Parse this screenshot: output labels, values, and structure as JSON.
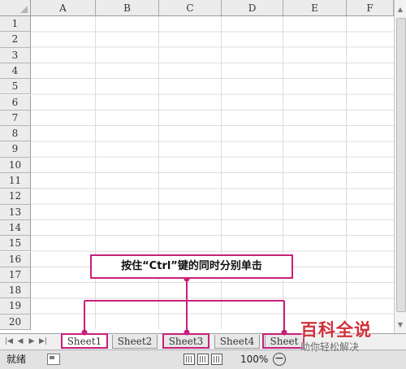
{
  "columns": [
    "A",
    "B",
    "C",
    "D",
    "E",
    "F"
  ],
  "rows": [
    "1",
    "2",
    "3",
    "4",
    "5",
    "6",
    "7",
    "8",
    "9",
    "10",
    "11",
    "12",
    "13",
    "14",
    "15",
    "16",
    "17",
    "18",
    "19",
    "20"
  ],
  "tabs": [
    {
      "label": "Sheet1",
      "highlighted": true
    },
    {
      "label": "Sheet2",
      "highlighted": false
    },
    {
      "label": "Sheet3",
      "highlighted": true
    },
    {
      "label": "Sheet4",
      "highlighted": false
    },
    {
      "label": "Sheet",
      "highlighted": true
    }
  ],
  "status": {
    "ready_text": "就绪",
    "zoom_level": "100%"
  },
  "callout": {
    "text": "按住“Ctrl”键的同时分别单击"
  },
  "watermark": {
    "title": "百科全说",
    "subtitle": "助你轻松解决"
  },
  "colors": {
    "highlight": "#c8207a",
    "header_bg": "#ececec",
    "watermark_red": "#d0303a"
  }
}
